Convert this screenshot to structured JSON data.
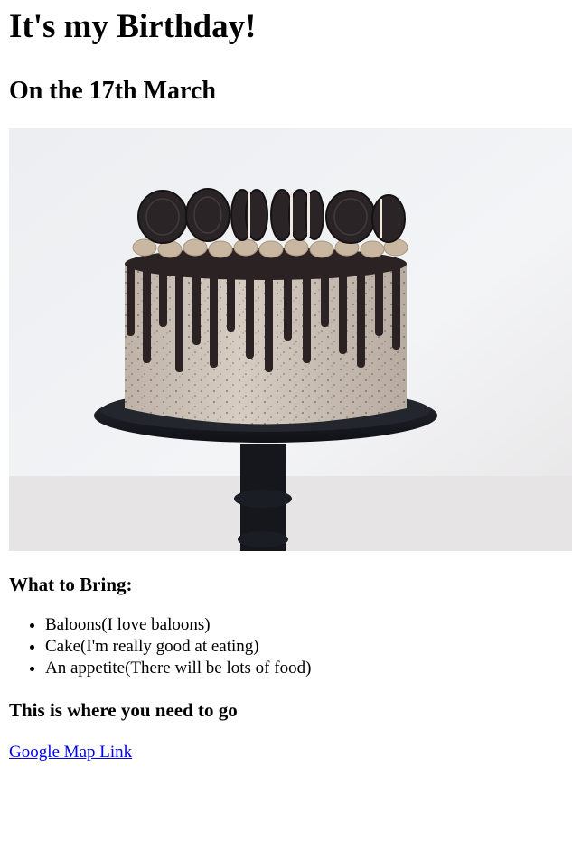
{
  "header": {
    "title": "It's my Birthday!",
    "date_line": "On the 17th March"
  },
  "hero_image": {
    "subject": "drip cake with sandwich cookies on a black cake stand"
  },
  "bring": {
    "heading": "What to Bring:",
    "items": [
      "Baloons(I love baloons)",
      "Cake(I'm really good at eating)",
      "An appetite(There will be lots of food)"
    ]
  },
  "location": {
    "heading": "This is where you need to go",
    "link_text": "Google Map Link"
  },
  "colors": {
    "link": "#0000ee",
    "text": "#000000",
    "background": "#ffffff"
  }
}
